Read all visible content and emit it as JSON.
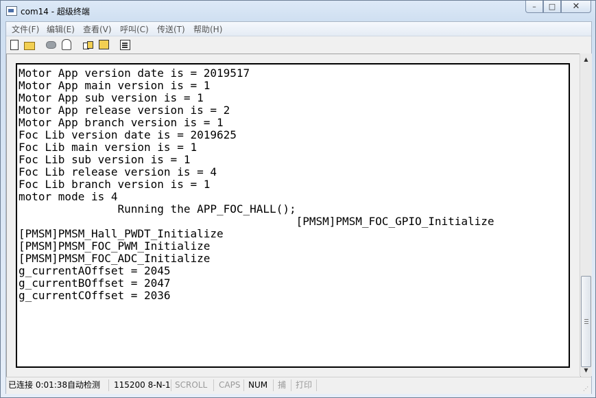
{
  "window": {
    "title": "com14 - 超级终端",
    "minimize_glyph": "–",
    "maximize_glyph": "□",
    "close_glyph": "✕"
  },
  "menu": [
    "文件(F)",
    "编辑(E)",
    "查看(V)",
    "呼叫(C)",
    "传送(T)",
    "帮助(H)"
  ],
  "toolbar": {
    "icons": [
      "new-file-icon",
      "open-folder-icon",
      "call-phone-icon",
      "disconnect-icon",
      "send-icon",
      "receive-icon",
      "properties-icon"
    ]
  },
  "terminal": {
    "lines": [
      "Motor App version date is = 2019517",
      "Motor App main version is = 1",
      "Motor App sub version is = 1",
      "Motor App release version is = 2",
      "Motor App branch version is = 1",
      "Foc Lib version date is = 2019625",
      "Foc Lib main version is = 1",
      "Foc Lib sub version is = 1",
      "Foc Lib release version is = 4",
      "Foc Lib branch version is = 1",
      "motor mode is 4",
      "               Running the APP_FOC_HALL();",
      "                                          [PMSM]PMSM_FOC_GPIO_Initialize",
      "[PMSM]PMSM_Hall_PWDT_Initialize",
      "[PMSM]PMSM_FOC_PWM_Initialize",
      "[PMSM]PMSM_FOC_ADC_Initialize",
      "g_currentAOffset = 2045",
      "g_currentBOffset = 2047",
      "g_currentCOffset = 2036"
    ]
  },
  "scrollbar": {
    "up_glyph": "▲",
    "down_glyph": "▼",
    "position": 0.8
  },
  "status": {
    "connected": "已连接 0:01:38",
    "detect": "自动检测",
    "settings": "115200 8-N-1",
    "scroll": "SCROLL",
    "caps": "CAPS",
    "num": "NUM",
    "capture": "捕",
    "print": "打印"
  }
}
